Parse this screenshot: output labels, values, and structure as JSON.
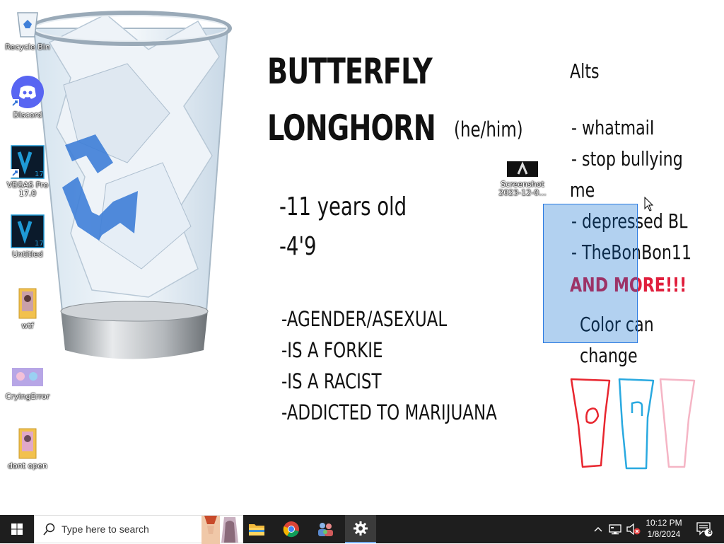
{
  "desktop": {
    "icons": [
      {
        "label": "Recycle Bin"
      },
      {
        "label": "Discord"
      },
      {
        "label": "VEGAS Pro 17.0"
      },
      {
        "label": "Untitled"
      },
      {
        "label": "wtf"
      },
      {
        "label": "CryingError"
      },
      {
        "label": "dont open"
      }
    ],
    "screenshot_icon": {
      "label_line1": "Screenshot",
      "label_line2": "2023-12-0..."
    }
  },
  "wallpaper": {
    "name_line1": "BUTTERFLY",
    "name_line2": "LONGHORN",
    "pronouns": "(he/him)",
    "facts": [
      "-11 years old",
      "-4'9"
    ],
    "traits": [
      "-AGENDER/ASEXUAL",
      "-IS A FORKIE",
      "-IS A RACIST",
      "-ADDICTED TO MARIJUANA"
    ],
    "alts_heading": "Alts",
    "alts": [
      "- whatmaiI",
      "- stop bullying",
      "me",
      "- depressed BL",
      "- TheBonBon11"
    ],
    "and_more": "AND MORE!!!",
    "color_note_line1": "Color can",
    "color_note_line2": "change",
    "color_variants": [
      "#e8262f",
      "#29a9e0",
      "#f5b5c5"
    ]
  },
  "taskbar": {
    "search_placeholder": "Type here to search",
    "clock_time": "10:12 PM",
    "clock_date": "1/8/2024",
    "notification_count": "8"
  },
  "colors": {
    "taskbar_bg": "#1e1e1e",
    "selection": "#2a7ae2",
    "discord_brand": "#5865f2",
    "vegas_brand": "#1f9ad6",
    "and_more_red": "#e01e3c"
  }
}
